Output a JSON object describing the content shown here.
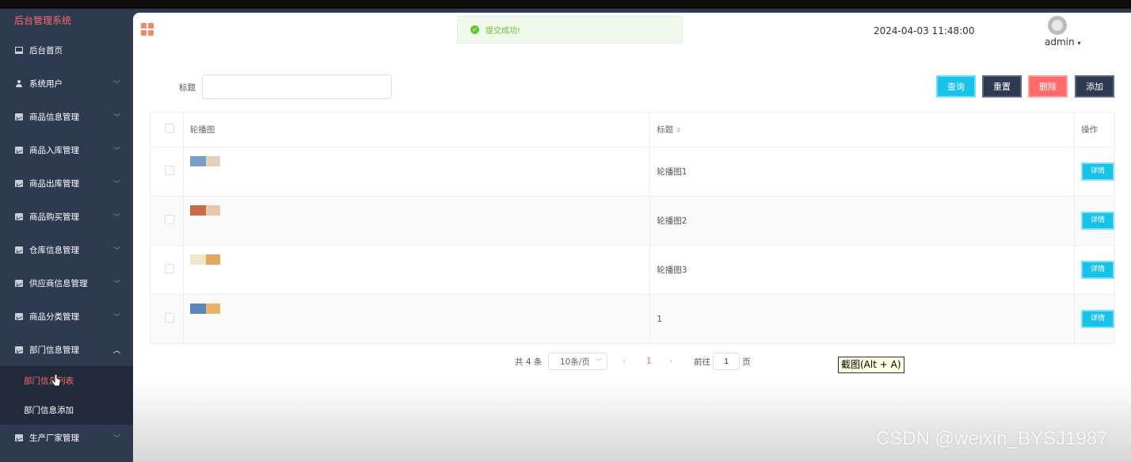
{
  "sidebar": {
    "brand": "后台管理系统",
    "items": [
      {
        "label": "后台首页",
        "icon": "monitor-icon"
      },
      {
        "label": "系统用户",
        "icon": "user-icon"
      },
      {
        "label": "商品信息管理",
        "icon": "chart-icon"
      },
      {
        "label": "商品入库管理",
        "icon": "chart-icon"
      },
      {
        "label": "商品出库管理",
        "icon": "chart-icon"
      },
      {
        "label": "商品购买管理",
        "icon": "chart-icon"
      },
      {
        "label": "仓库信息管理",
        "icon": "chart-icon"
      },
      {
        "label": "供应商信息管理",
        "icon": "chart-icon"
      },
      {
        "label": "商品分类管理",
        "icon": "chart-icon"
      },
      {
        "label": "部门信息管理",
        "icon": "chart-icon"
      }
    ],
    "sub_items": [
      {
        "label": "部门信息列表"
      },
      {
        "label": "部门信息添加"
      }
    ],
    "last_item": {
      "label": "生产厂家管理",
      "icon": "chart-icon"
    }
  },
  "header": {
    "toast": "提交成功!",
    "datetime": "2024-04-03 11:48:00",
    "user": "admin"
  },
  "search": {
    "label": "标题",
    "value": "",
    "placeholder": ""
  },
  "toolbar": {
    "query": "查询",
    "reset": "重置",
    "delete": "删除",
    "add": "添加"
  },
  "table": {
    "columns": [
      "轮播图",
      "标题",
      "操作"
    ],
    "rows": [
      {
        "title": "轮播图1",
        "action": "详情",
        "thumb_colors": [
          "#7aa0c8",
          "#e0d2b8"
        ]
      },
      {
        "title": "轮播图2",
        "action": "详情",
        "thumb_colors": [
          "#c96a48",
          "#e8c7b0"
        ]
      },
      {
        "title": "轮播图3",
        "action": "详情",
        "thumb_colors": [
          "#f1e6cc",
          "#e0a860"
        ]
      },
      {
        "title": "1",
        "action": "详情",
        "thumb_colors": [
          "#5b86b8",
          "#e7b46a"
        ]
      }
    ]
  },
  "pagination": {
    "total": "共 4 条",
    "page_size": "10条/页",
    "prev": "‹",
    "current": "1",
    "next": "›",
    "goto_label": "前往",
    "goto_value": "1",
    "page_label": "页"
  },
  "overlay": {
    "tooltip": "截图(Alt + A)",
    "watermark": "CSDN @weixin_BYSJ1987"
  }
}
